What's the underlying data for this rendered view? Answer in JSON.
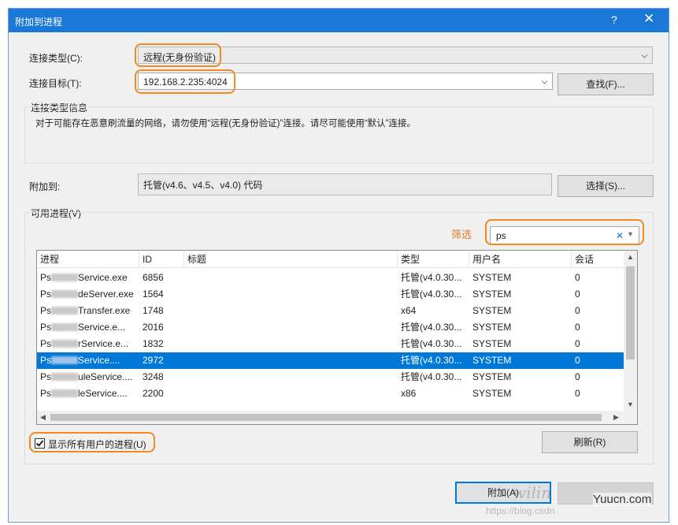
{
  "window": {
    "title": "附加到进程",
    "help_glyph": "?",
    "close_glyph": "✕"
  },
  "connection": {
    "type_label": "连接类型(C):",
    "type_value": "远程(无身份验证)",
    "target_label": "连接目标(T):",
    "target_value": "192.168.2.235:4024",
    "find_button": "查找(F)..."
  },
  "info": {
    "group_label": "连接类型信息",
    "text": "对于可能存在恶意刷流量的网络，请勿使用“远程(无身份验证)”连接。请尽可能使用“默认”连接。"
  },
  "attach_to": {
    "label": "附加到:",
    "value": "托管(v4.6、v4.5、v4.0) 代码",
    "select_button": "选择(S)..."
  },
  "processes": {
    "group_label": "可用进程(V)",
    "filter_label": "筛选",
    "filter_value": "ps",
    "clear_glyph": "✕",
    "dropdown_glyph": "▾",
    "columns": [
      "进程",
      "ID",
      "标题",
      "类型",
      "用户名",
      "会话"
    ],
    "rows": [
      {
        "prefix": "Ps",
        "suffix": "Service.exe",
        "id": "6856",
        "title": "",
        "type": "托管(v4.0.30...",
        "user": "SYSTEM",
        "session": "0",
        "selected": false
      },
      {
        "prefix": "Ps",
        "suffix": "deServer.exe",
        "id": "1564",
        "title": "",
        "type": "托管(v4.0.30...",
        "user": "SYSTEM",
        "session": "0",
        "selected": false
      },
      {
        "prefix": "Ps",
        "suffix": "Transfer.exe",
        "id": "1748",
        "title": "",
        "type": "x64",
        "user": "SYSTEM",
        "session": "0",
        "selected": false
      },
      {
        "prefix": "Ps",
        "suffix": "Service.e...",
        "id": "2016",
        "title": "",
        "type": "托管(v4.0.30...",
        "user": "SYSTEM",
        "session": "0",
        "selected": false
      },
      {
        "prefix": "Ps",
        "suffix": "rService.e...",
        "id": "1832",
        "title": "",
        "type": "托管(v4.0.30...",
        "user": "SYSTEM",
        "session": "0",
        "selected": false
      },
      {
        "prefix": "Ps",
        "suffix": "Service....",
        "id": "2972",
        "title": "",
        "type": "托管(v4.0.30...",
        "user": "SYSTEM",
        "session": "0",
        "selected": true
      },
      {
        "prefix": "Ps",
        "suffix": "uleService....",
        "id": "3248",
        "title": "",
        "type": "托管(v4.0.30...",
        "user": "SYSTEM",
        "session": "0",
        "selected": false
      },
      {
        "prefix": "Ps",
        "suffix": "leService....",
        "id": "2200",
        "title": "",
        "type": "x86",
        "user": "SYSTEM",
        "session": "0",
        "selected": false
      }
    ],
    "show_all_label": "显示所有用户的进程(U)",
    "show_all_checked": true,
    "refresh_button": "刷新(R)"
  },
  "footer": {
    "attach_button": "附加(A)",
    "watermark_text": "Yuucn.com",
    "watermark_url": "https://blog.csdn"
  },
  "colors": {
    "titlebar": "#1a78d6",
    "highlight": "#f08a24",
    "selection": "#0078d7"
  }
}
